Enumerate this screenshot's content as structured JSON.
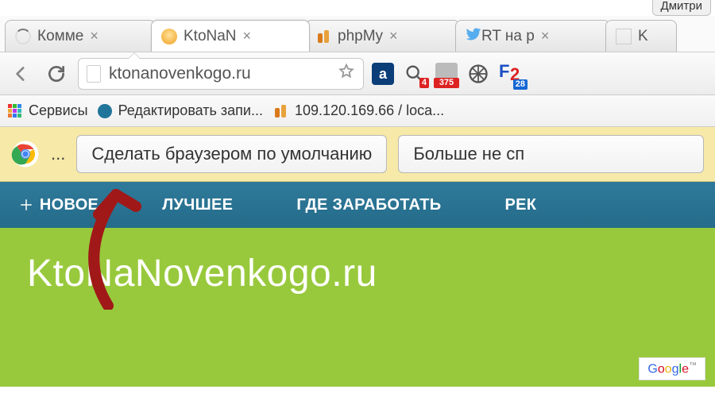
{
  "status": {
    "user": "Дмитри"
  },
  "tabs": [
    {
      "label": "Комме",
      "icon": "spinner"
    },
    {
      "label": "KtoNaN",
      "icon": "bulb",
      "active": true
    },
    {
      "label": "phpMy",
      "icon": "pma"
    },
    {
      "label": "RT на р",
      "icon": "twitter"
    },
    {
      "label": "K",
      "icon": "blank"
    }
  ],
  "omnibox": {
    "url": "ktonanovenkogo.ru"
  },
  "toolbar_ext": {
    "alexa_badge": "a",
    "count4": "4",
    "count375": "375",
    "count28": "28"
  },
  "bookmarks": {
    "apps": "Сервисы",
    "wp": "Редактировать запи...",
    "pma": "109.120.169.66 / loca..."
  },
  "infobar": {
    "default_btn": "Сделать браузером по умолчанию",
    "dismiss_btn": "Больше не сп"
  },
  "site_nav": {
    "items": [
      "НОВОЕ",
      "ЛУЧШЕЕ",
      "ГДЕ ЗАРАБОТАТЬ",
      "РЕК"
    ]
  },
  "hero": {
    "title": "KtoNaNovenkogo.ru",
    "google_label": "Google"
  }
}
